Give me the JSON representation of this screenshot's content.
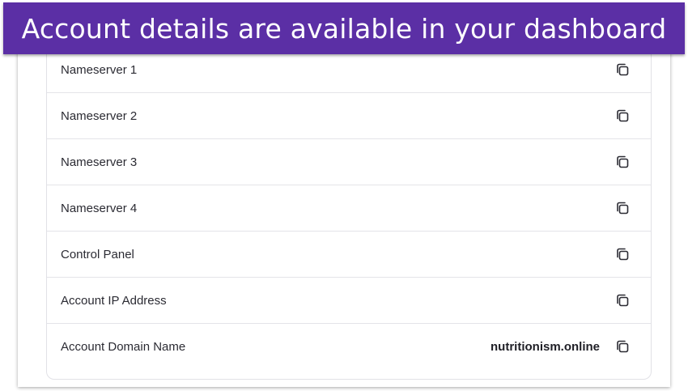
{
  "banner": {
    "title": "Account details are available in your dashboard"
  },
  "account_details": {
    "rows": [
      {
        "label": "Nameserver 1",
        "value": ""
      },
      {
        "label": "Nameserver 2",
        "value": ""
      },
      {
        "label": "Nameserver 3",
        "value": ""
      },
      {
        "label": "Nameserver 4",
        "value": ""
      },
      {
        "label": "Control Panel",
        "value": ""
      },
      {
        "label": "Account IP Address",
        "value": ""
      },
      {
        "label": "Account Domain Name",
        "value": "nutritionism.online"
      }
    ],
    "copy_icon": "copy-icon"
  },
  "colors": {
    "banner_bg": "#5b2fa5",
    "banner_text": "#ffffff",
    "divider": "#e4e4e8"
  }
}
